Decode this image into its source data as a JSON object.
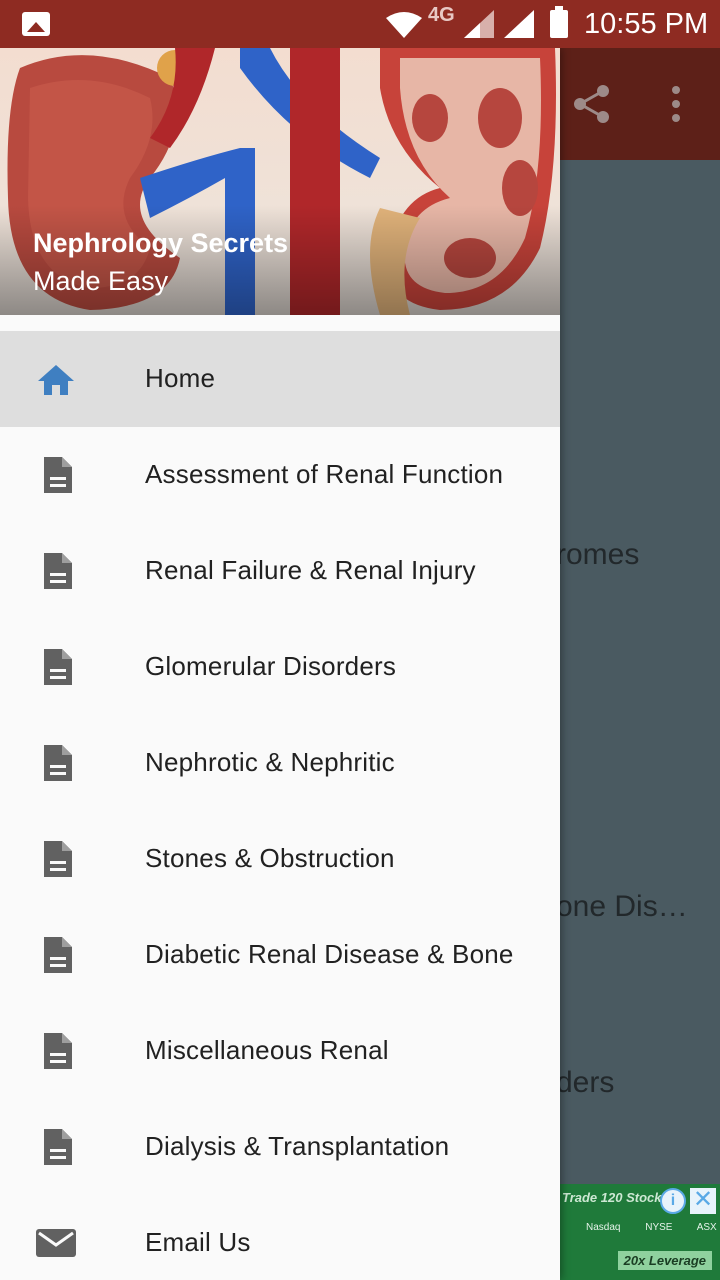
{
  "status_bar": {
    "network": "4G",
    "time": "10:55 PM"
  },
  "drawer": {
    "title": "Nephrology Secrets",
    "subtitle": "Made Easy",
    "items": [
      {
        "label": "Home",
        "icon": "home-icon",
        "selected": true
      },
      {
        "label": "Assessment of Renal Function",
        "icon": "document-icon"
      },
      {
        "label": "Renal Failure & Renal Injury",
        "icon": "document-icon"
      },
      {
        "label": "Glomerular Disorders",
        "icon": "document-icon"
      },
      {
        "label": "Nephrotic & Nephritic",
        "icon": "document-icon"
      },
      {
        "label": "Stones & Obstruction",
        "icon": "document-icon"
      },
      {
        "label": "Diabetic Renal Disease & Bone",
        "icon": "document-icon"
      },
      {
        "label": "Miscellaneous Renal",
        "icon": "document-icon"
      },
      {
        "label": "Dialysis & Transplantation",
        "icon": "document-icon"
      },
      {
        "label": "Email Us",
        "icon": "email-icon"
      }
    ]
  },
  "background": {
    "visible_texts": [
      "romes",
      "one Dis…",
      "ders"
    ]
  },
  "ad": {
    "top_text": "Trade 120 Stock",
    "mid_text": "Nasdaq NYSE ASX",
    "bottom_text": "20x Leverage",
    "info_symbol": "i",
    "close_symbol": "✕"
  },
  "colors": {
    "status_bar": "#8e2b22",
    "accent_icon": "#3f7fc1",
    "item_icon": "#616161",
    "selected_bg": "#dedede"
  }
}
